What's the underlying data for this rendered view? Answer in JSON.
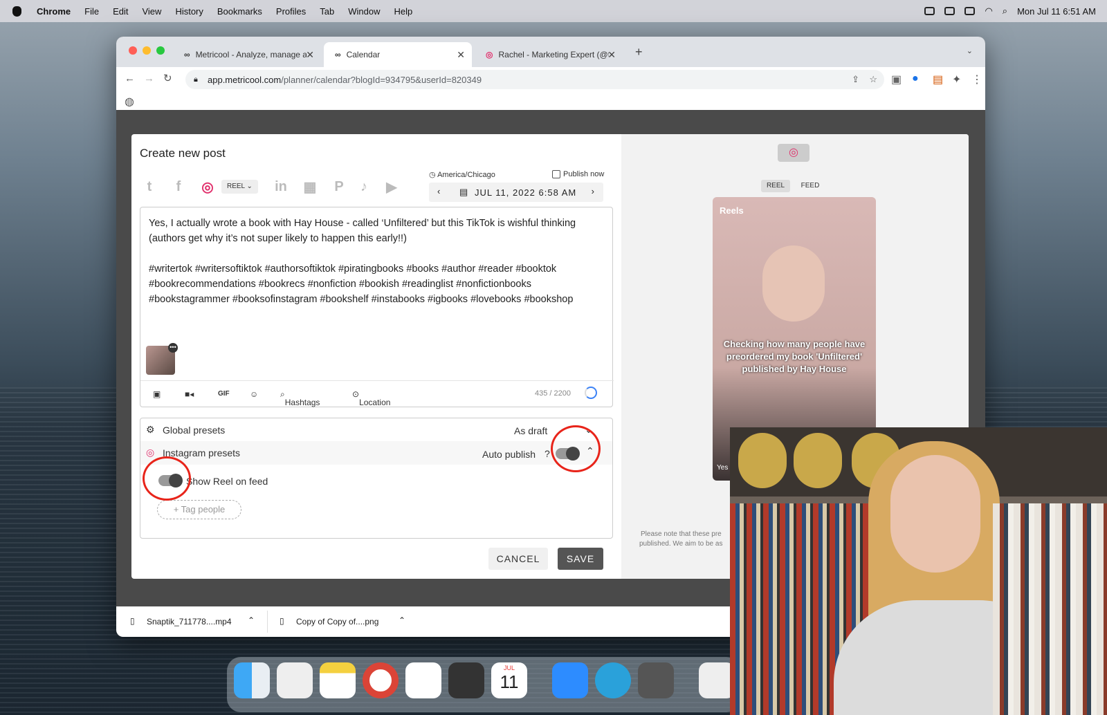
{
  "menubar": {
    "app": "Chrome",
    "items": [
      "File",
      "Edit",
      "View",
      "History",
      "Bookmarks",
      "Profiles",
      "Tab",
      "Window",
      "Help"
    ],
    "clock": "Mon Jul 11  6:51 AM"
  },
  "browser": {
    "tabs": [
      {
        "label": "Metricool - Analyze, manage a"
      },
      {
        "label": "Calendar"
      },
      {
        "label": "Rachel - Marketing Expert (@t"
      }
    ],
    "url_host": "app.metricool.com",
    "url_path": "/planner/calendar?blogId=934795&userId=820349"
  },
  "post": {
    "title": "Create new post",
    "type_label": "REEL",
    "timezone": "America/Chicago",
    "publish_now": "Publish now",
    "datetime": "JUL 11, 2022 6:58 AM",
    "text_line1": "Yes, I actually wrote a book with Hay House - called ‘Unfiltered’ but this TikTok is wishful thinking",
    "text_line2": "(authors get why it’s not super likely to happen this early!!)",
    "hashtags1": "#writertok #writersoftiktok #authorsoftiktok #piratingbooks #books #author #reader #booktok",
    "hashtags2": "#bookrecommendations #bookrecs #nonfiction #bookish #readinglist  #nonfictionbooks",
    "hashtags3": "#bookstagrammer  #booksofinstagram  #bookshelf  #instabooks  #igbooks  #lovebooks  #bookshop",
    "tool_gif": "GIF",
    "tool_hashtags": "Hashtags",
    "tool_location": "Location",
    "char_count": "435 / 2200",
    "global_presets": "Global presets",
    "global_value": "As draft",
    "ig_presets": "Instagram presets",
    "ig_value": "Auto publish",
    "help": "?",
    "show_reel": "Show Reel on feed",
    "tag_people": "+ Tag people",
    "cancel": "CANCEL",
    "save": "SAVE"
  },
  "preview": {
    "tab_reel": "REEL",
    "tab_feed": "FEED",
    "reels_label": "Reels",
    "caption": "Checking how many people have preordered my book 'Unfiltered' published by Hay House",
    "note1": "Please note that these pre",
    "note2": "published. We aim to be as",
    "user": "Yes"
  },
  "downloads": [
    {
      "name": "Snaptik_711778....mp4"
    },
    {
      "name": "Copy of Copy of....png"
    }
  ],
  "dock": {
    "calendar_month": "JUL",
    "calendar_day": "11"
  },
  "colors": {
    "instagram": "#e1306c",
    "ring": "#e8241a",
    "save": "#555555"
  }
}
